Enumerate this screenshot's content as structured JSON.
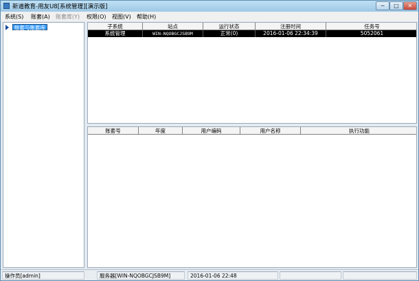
{
  "window": {
    "title": "新道教育-用友U8[系统管理][演示版]"
  },
  "menu": [
    {
      "label": "系统(S)",
      "disabled": false
    },
    {
      "label": "账套(A)",
      "disabled": false
    },
    {
      "label": "账套库(Y)",
      "disabled": true
    },
    {
      "label": "权限(O)",
      "disabled": false
    },
    {
      "label": "视图(V)",
      "disabled": false
    },
    {
      "label": "帮助(H)",
      "disabled": false
    }
  ],
  "tree": {
    "items": [
      {
        "label": "账套与账套库"
      }
    ]
  },
  "top_grid": {
    "headers": [
      "子系统",
      "站点",
      "运行状态",
      "注册时间",
      "任务号"
    ],
    "rows": [
      [
        "系统管理",
        "WIN-NQOBGCJSB9M",
        "正常(0)",
        "2016-01-06 22:34:39",
        "5052061"
      ]
    ]
  },
  "bottom_grid": {
    "headers": [
      "账套号",
      "年度",
      "用户编码",
      "用户名称",
      "执行功能"
    ]
  },
  "status": {
    "operator": "操作员[admin]",
    "server": "服务器[WIN-NQOBGCJSB9M]",
    "datetime": "2016-01-06 22:48",
    "empty1": "",
    "empty2": ""
  }
}
